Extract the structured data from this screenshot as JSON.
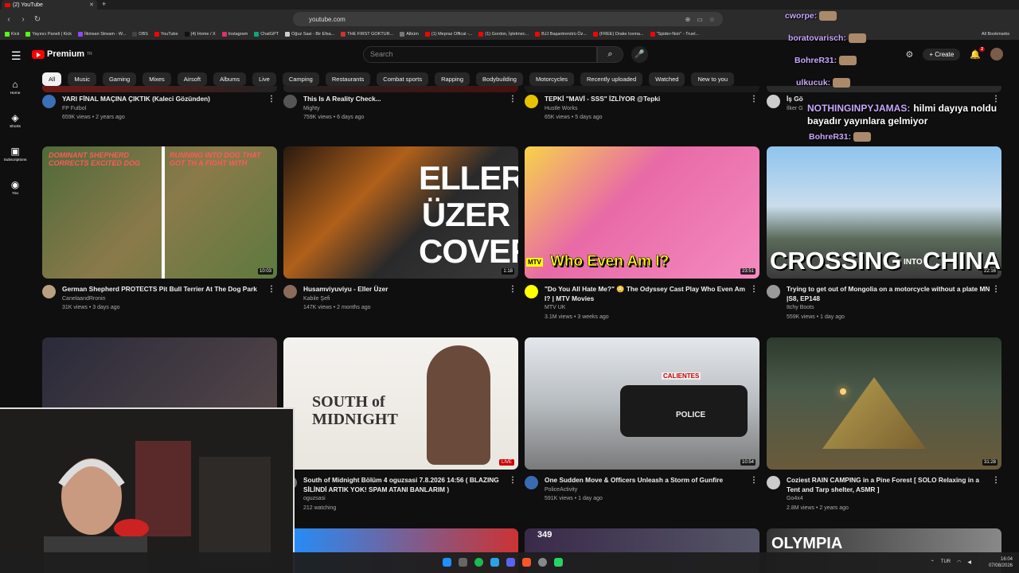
{
  "browser": {
    "tab_title": "(2) YouTube",
    "url": "youtube.com",
    "bookmarks": [
      "Kick",
      "Yayıncı Paneli | Kick",
      "İlkinsan Stream - W...",
      "OBS",
      "YouTube",
      "(4) Home / X",
      "Instagram",
      "ChatGPT",
      "Oğuz Sasi - Bir Efsa...",
      "THE FIRST GOKTUR...",
      "Albüm",
      "(1) Mepraz Offical -...",
      "(1) Gordon, İşletmec...",
      "BJJ Başantrenörü Öz...",
      "(FREE) Drake Icema...",
      "\"Spider-Noir\" - Truel..."
    ],
    "all_bookmarks": "All Bookmarks"
  },
  "header": {
    "logo_text": "Premium",
    "logo_sup": "TR",
    "search_placeholder": "Search",
    "create_label": "Create",
    "notif_count": "2"
  },
  "sidebar": [
    {
      "label": "Home",
      "icon": "home-icon"
    },
    {
      "label": "Shorts",
      "icon": "shorts-icon"
    },
    {
      "label": "Subscriptions",
      "icon": "subscriptions-icon"
    },
    {
      "label": "You",
      "icon": "you-icon"
    }
  ],
  "chips": [
    "All",
    "Music",
    "Gaming",
    "Mixes",
    "Airsoft",
    "Albums",
    "Live",
    "Camping",
    "Restaurants",
    "Combat sports",
    "Rapping",
    "Bodybuilding",
    "Motorcycles",
    "Recently uploaded",
    "Watched",
    "New to you"
  ],
  "row0": [
    {
      "title": "YARI FİNAL MAÇINA ÇIKTIK (Kaleci Gözünden)",
      "channel": "FP Futbol",
      "stats": "659K views • 2 years ago"
    },
    {
      "title": "This Is A Reality Check...",
      "channel": "Mighty",
      "stats": "759K views • 6 days ago"
    },
    {
      "title": "TEPKİ \"MAVİ - SSS\" İZLİYOR @Tepki",
      "channel": "Hustle Works",
      "stats": "65K views • 5 days ago"
    },
    {
      "title": "İş Gö",
      "channel": "İlker G",
      "stats": ""
    }
  ],
  "row1": [
    {
      "title": "German Shepherd PROTECTS Pit Bull Terrier At The Dog Park",
      "channel": "CanelaandRronin",
      "stats": "31K views • 3 days ago",
      "duration": "10:03",
      "overlay_top": "DOMINANT SHEPHERD CORRECTS EXCITED DOG",
      "overlay_right": "RUNNING INTO DOG THAT GOT TH A FIGHT WITH"
    },
    {
      "title": "Husamviyuviyu - Eller Üzer",
      "channel": "Kabile Şefi",
      "stats": "147K views • 2 months ago",
      "duration": "1:18",
      "overlay": [
        "ELLER",
        "ÜZER",
        "COVER"
      ]
    },
    {
      "title": "\"Do You All Hate Me?\" 😳 The Odyssey Cast Play Who Even Am I? | MTV Movies",
      "channel": "MTV UK",
      "stats": "3.1M views • 3 weeks ago",
      "duration": "23:51",
      "overlay": "Who Even Am I?",
      "logo": "MTV"
    },
    {
      "title": "Trying to get out of Mongolia on a motorcycle without a plate MN |S8, EP148",
      "channel": "Itchy Boots",
      "stats": "559K views • 1 day ago",
      "duration": "22:16",
      "overlay": "CROSSING",
      "overlay_small": "INTO",
      "overlay2": "CHINA"
    }
  ],
  "row2": [
    {
      "title": "",
      "channel": "",
      "stats": ""
    },
    {
      "title": "South of Midnight Bölüm 4 oguzsasi 7.8.2026 14:56 ( BLAZING SİLİNDİ ARTIK YOK! SPAM ATANI BANLARIM )",
      "channel": "oguzsasi",
      "stats": "212 watching",
      "live": "LIVE",
      "overlay": "SOUTH of MIDNIGHT"
    },
    {
      "title": "One Sudden Move & Officers Unleash a Storm of Gunfire",
      "channel": "PoliceActivity",
      "stats": "591K views • 1 day ago",
      "duration": "10:54",
      "overlay": "POLICE",
      "overlay2": "CALIENTES"
    },
    {
      "title": "Coziest RAIN CAMPING in a Pine Forest [ SOLO Relaxing in a Tent and Tarp shelter, ASMR ]",
      "channel": "Go4x4",
      "stats": "2.8M views • 2 years ago",
      "duration": "31:28"
    }
  ],
  "row3_texts": [
    "349",
    "OLYMPIA"
  ],
  "chat": [
    {
      "name": "cworpe:",
      "text": ""
    },
    {
      "name": "boratovarisch:",
      "text": ""
    },
    {
      "name": "BohreR31:",
      "text": ""
    },
    {
      "name": "ulkucuk:",
      "text": ""
    },
    {
      "name": "NOTHINGINPYJAMAS:",
      "text": "hilmi dayıya noldu bayadır yayınlara gelmiyor"
    },
    {
      "name": "BohreR31:",
      "text": ""
    }
  ],
  "taskbar": {
    "lang": "TUR",
    "time": "16:04",
    "date": "07/08/2026"
  },
  "colors": {
    "bg": "#0f0f0f",
    "chip": "#272727",
    "accent": "#ff0000"
  }
}
